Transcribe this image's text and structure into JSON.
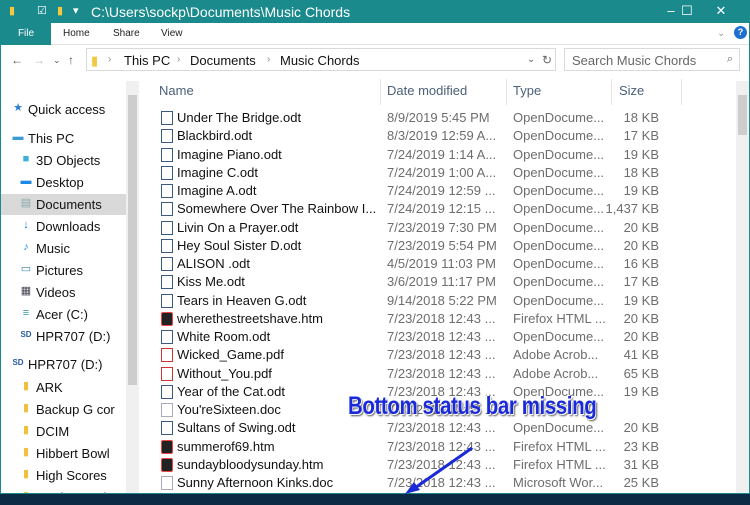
{
  "window": {
    "title": "C:\\Users\\sockp\\Documents\\Music Chords",
    "accent": "#1a8a8c"
  },
  "ribbon": {
    "tabs": [
      "File",
      "Home",
      "Share",
      "View"
    ]
  },
  "address": {
    "crumbs": [
      "This PC",
      "Documents",
      "Music Chords"
    ],
    "search_placeholder": "Search Music Chords"
  },
  "nav": [
    {
      "label": "Quick access",
      "icon": "star-icon",
      "indent": 0
    },
    {
      "label": "This PC",
      "icon": "computer-icon",
      "indent": 0
    },
    {
      "label": "3D Objects",
      "icon": "cube-icon",
      "indent": 1
    },
    {
      "label": "Desktop",
      "icon": "desktop-icon",
      "indent": 1
    },
    {
      "label": "Documents",
      "icon": "document-icon",
      "indent": 1,
      "selected": true
    },
    {
      "label": "Downloads",
      "icon": "download-icon",
      "indent": 1
    },
    {
      "label": "Music",
      "icon": "music-icon",
      "indent": 1
    },
    {
      "label": "Pictures",
      "icon": "pictures-icon",
      "indent": 1
    },
    {
      "label": "Videos",
      "icon": "videos-icon",
      "indent": 1
    },
    {
      "label": "Acer (C:)",
      "icon": "drive-icon",
      "indent": 1
    },
    {
      "label": "HPR707 (D:)",
      "icon": "sd-card-icon",
      "indent": 1
    },
    {
      "label": "HPR707 (D:)",
      "icon": "sd-card-icon",
      "indent": 0
    },
    {
      "label": "ARK",
      "icon": "folder-icon",
      "indent": 1
    },
    {
      "label": "Backup G cor",
      "icon": "folder-icon",
      "indent": 1
    },
    {
      "label": "DCIM",
      "icon": "folder-icon",
      "indent": 1
    },
    {
      "label": "Hibbert Bowl",
      "icon": "folder-icon",
      "indent": 1
    },
    {
      "label": "High Scores",
      "icon": "folder-icon",
      "indent": 1
    },
    {
      "label": "Music To Prin",
      "icon": "folder-icon",
      "indent": 1
    }
  ],
  "columns": [
    "Name",
    "Date modified",
    "Type",
    "Size"
  ],
  "files": [
    {
      "name": "Under The Bridge.odt",
      "date": "8/9/2019 5:45 PM",
      "type": "OpenDocume...",
      "size": "18 KB",
      "kind": "odt"
    },
    {
      "name": "Blackbird.odt",
      "date": "8/3/2019 12:59 A...",
      "type": "OpenDocume...",
      "size": "17 KB",
      "kind": "odt"
    },
    {
      "name": "Imagine Piano.odt",
      "date": "7/24/2019 1:14 A...",
      "type": "OpenDocume...",
      "size": "19 KB",
      "kind": "odt"
    },
    {
      "name": "Imagine C.odt",
      "date": "7/24/2019 1:00 A...",
      "type": "OpenDocume...",
      "size": "18 KB",
      "kind": "odt"
    },
    {
      "name": "Imagine A.odt",
      "date": "7/24/2019 12:59 ...",
      "type": "OpenDocume...",
      "size": "19 KB",
      "kind": "odt"
    },
    {
      "name": "Somewhere Over The Rainbow I...",
      "date": "7/24/2019 12:15 ...",
      "type": "OpenDocume...",
      "size": "1,437 KB",
      "kind": "odt"
    },
    {
      "name": "Livin On a Prayer.odt",
      "date": "7/23/2019 7:30 PM",
      "type": "OpenDocume...",
      "size": "20 KB",
      "kind": "odt"
    },
    {
      "name": "Hey Soul Sister D.odt",
      "date": "7/23/2019 5:54 PM",
      "type": "OpenDocume...",
      "size": "20 KB",
      "kind": "odt"
    },
    {
      "name": "ALISON .odt",
      "date": "4/5/2019 11:03 PM",
      "type": "OpenDocume...",
      "size": "16 KB",
      "kind": "odt"
    },
    {
      "name": "Kiss Me.odt",
      "date": "3/6/2019 11:17 PM",
      "type": "OpenDocume...",
      "size": "17 KB",
      "kind": "odt"
    },
    {
      "name": "Tears in Heaven G.odt",
      "date": "9/14/2018 5:22 PM",
      "type": "OpenDocume...",
      "size": "19 KB",
      "kind": "odt"
    },
    {
      "name": "wherethestreetshave.htm",
      "date": "7/23/2018 12:43 ...",
      "type": "Firefox HTML ...",
      "size": "20 KB",
      "kind": "htm"
    },
    {
      "name": "White Room.odt",
      "date": "7/23/2018 12:43 ...",
      "type": "OpenDocume...",
      "size": "20 KB",
      "kind": "odt"
    },
    {
      "name": "Wicked_Game.pdf",
      "date": "7/23/2018 12:43 ...",
      "type": "Adobe Acrob...",
      "size": "41 KB",
      "kind": "pdf"
    },
    {
      "name": "Without_You.pdf",
      "date": "7/23/2018 12:43 ...",
      "type": "Adobe Acrob...",
      "size": "65 KB",
      "kind": "pdf"
    },
    {
      "name": "Year of the Cat.odt",
      "date": "7/23/2018 12:43 ...",
      "type": "OpenDocume...",
      "size": "19 KB",
      "kind": "odt"
    },
    {
      "name": "You'reSixteen.doc",
      "date": "7/23/2018 12:43 ...",
      "type": "",
      "size": "",
      "kind": "doc"
    },
    {
      "name": "Sultans of Swing.odt",
      "date": "7/23/2018 12:43 ...",
      "type": "OpenDocume...",
      "size": "20 KB",
      "kind": "odt"
    },
    {
      "name": "summerof69.htm",
      "date": "7/23/2018 12:43 ...",
      "type": "Firefox HTML ...",
      "size": "23 KB",
      "kind": "htm"
    },
    {
      "name": "sundaybloodysunday.htm",
      "date": "7/23/2018 12:43 ...",
      "type": "Firefox HTML ...",
      "size": "31 KB",
      "kind": "htm"
    },
    {
      "name": "Sunny Afternoon Kinks.doc",
      "date": "7/23/2018 12:43 ...",
      "type": "Microsoft Wor...",
      "size": "25 KB",
      "kind": "doc"
    }
  ],
  "annotation": {
    "text": "Bottom status bar missing",
    "color": "#1a2ad8"
  }
}
